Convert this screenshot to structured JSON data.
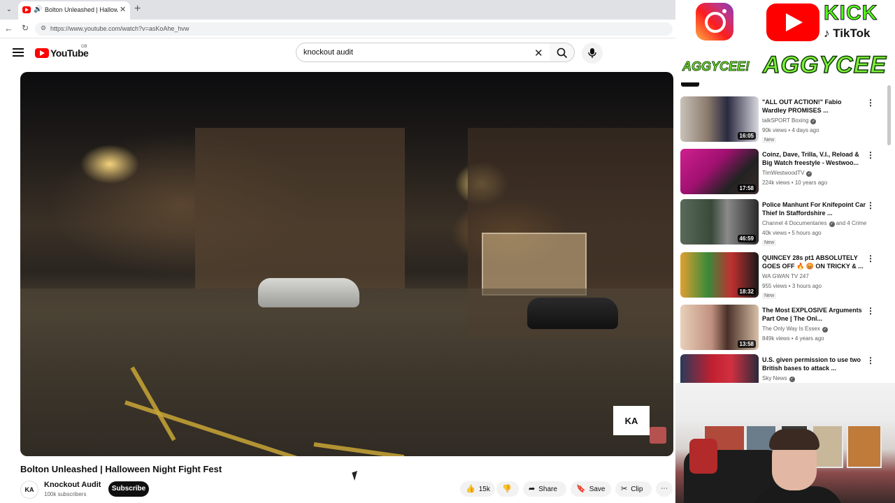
{
  "browser": {
    "tab_title": "Bolton Unleashed | Halloween...",
    "tab_close": "✕",
    "new_tab": "+",
    "url": "https://www.youtube.com/watch?v=asKoAhe_hvw"
  },
  "youtube": {
    "logo_text": "YouTube",
    "logo_country": "GB",
    "search_query": "knockout audit"
  },
  "video": {
    "title": "Bolton Unleashed | Halloween Night Fight Fest",
    "watermark": "KA",
    "channel_name": "Knockout Audit",
    "channel_avatar_text": "KA",
    "subscribers": "100k subscribers",
    "subscribe_label": "Subscribe",
    "likes": "15k",
    "share_label": "Share",
    "save_label": "Save",
    "clip_label": "Clip"
  },
  "overlay": {
    "kick": "KICK",
    "tiktok": "TikTok",
    "handle_small": "AGGYCEE!",
    "handle_big": "AGGYCEE"
  },
  "recommendations": [
    {
      "title": "\"ALL OUT ACTION!\" Fabio Wardley PROMISES ...",
      "channel": "talkSPORT Boxing",
      "verified": true,
      "meta": "90k views • 4 days ago",
      "badge": "New",
      "duration": "16:05",
      "thumb": "thumb-1"
    },
    {
      "title": "Coinz, Dave, Trilla, V.I., Reload & Big Watch freestyle - Westwoo...",
      "channel": "TimWestwoodTV",
      "verified": true,
      "meta": "224k views • 10 years ago",
      "badge": "",
      "duration": "17:58",
      "thumb": "thumb-2"
    },
    {
      "title": "Police Manhunt For Knifepoint Car Thief In Staffordshire ...",
      "channel": "Channel 4 Documentaries",
      "verified": true,
      "channel_suffix": "and 4 Crime",
      "meta": "40k views • 5 hours ago",
      "badge": "New",
      "duration": "46:59",
      "thumb": "thumb-3"
    },
    {
      "title": "QUINCEY 28s pt1 ABSOLUTELY GOES OFF 🔥 😡 ON TRICKY & ...",
      "channel": "WA GWAN TV 247",
      "verified": false,
      "meta": "955 views • 3 hours ago",
      "badge": "New",
      "duration": "18:32",
      "thumb": "thumb-4"
    },
    {
      "title": "The Most EXPLOSIVE Arguments Part One | The Onl...",
      "channel": "The Only Way Is Essex",
      "verified": true,
      "meta": "849k views • 4 years ago",
      "badge": "",
      "duration": "13:58",
      "thumb": "thumb-5"
    },
    {
      "title": "U.S. given permission to use two British bases to attack ...",
      "channel": "Sky News",
      "verified": true,
      "meta": "",
      "badge": "",
      "duration": "",
      "thumb": "thumb-6"
    }
  ],
  "colors": {
    "youtube_red": "#ff0000",
    "kick_green": "#53fc18",
    "aggycee_green": "#7ef03a"
  }
}
